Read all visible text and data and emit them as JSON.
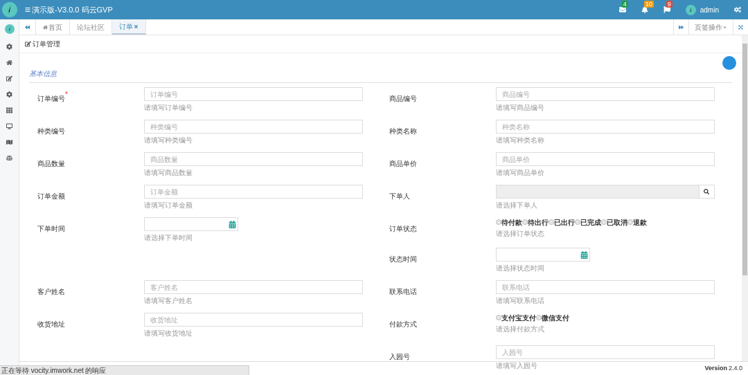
{
  "header": {
    "title": "演示版-V3.0.0 码云GVP",
    "badges": [
      {
        "kind": "mail",
        "count": "4",
        "color": "#1e9e4a"
      },
      {
        "kind": "bell",
        "count": "10",
        "color": "#f39c12"
      },
      {
        "kind": "flag",
        "count": "9",
        "color": "#dd4b39"
      }
    ],
    "user": "admin"
  },
  "tabs": [
    {
      "label": "首页",
      "selected": false
    },
    {
      "label": "论坛社区",
      "selected": false
    },
    {
      "label": "订单",
      "selected": true
    }
  ],
  "tab_menu": "页签操作",
  "panel": {
    "title": "订单管理",
    "section": "基本信息"
  },
  "rows": [
    {
      "left": {
        "kind": "text",
        "label": "订单编号",
        "required_mark": "*",
        "placeholder": "订单编号",
        "help": "请填写订单编号"
      },
      "right": {
        "kind": "text",
        "label": "商品编号",
        "placeholder": "商品编号",
        "help": "请填写商品编号"
      }
    },
    {
      "left": {
        "kind": "text",
        "label": "种类编号",
        "placeholder": "种类编号",
        "help": "请填写种类编号"
      },
      "right": {
        "kind": "text",
        "label": "种类名称",
        "placeholder": "种类名称",
        "help": "请填写种类名称"
      }
    },
    {
      "left": {
        "kind": "text",
        "label": "商品数量",
        "placeholder": "商品数量",
        "help": "请填写商品数量"
      },
      "right": {
        "kind": "text",
        "label": "商品单价",
        "placeholder": "商品单价",
        "help": "请填写商品单价"
      }
    },
    {
      "left": {
        "kind": "text",
        "label": "订单金额",
        "placeholder": "订单金额",
        "help": "请填写订单金额"
      },
      "right": {
        "kind": "lookup",
        "label": "下单人",
        "help": "请选择下单人"
      }
    },
    {
      "left": {
        "kind": "date",
        "label": "下单时间",
        "help": "请选择下单时间"
      },
      "right": {
        "kind": "radio",
        "label": "订单状态",
        "help": "请选择订单状态",
        "options": [
          {
            "label": "待付款",
            "selected": false
          },
          {
            "label": "待出行",
            "selected": false
          },
          {
            "label": "已出行",
            "selected": false
          },
          {
            "label": "已完成",
            "selected": false
          },
          {
            "label": "已取消",
            "selected": false
          },
          {
            "label": "退款",
            "selected": false
          }
        ]
      }
    },
    {
      "right": {
        "kind": "date",
        "label": "状态时间",
        "help": "请选择状态时间"
      }
    },
    {
      "left": {
        "kind": "text",
        "label": "客户姓名",
        "placeholder": "客户姓名",
        "help": "请填写客户姓名"
      },
      "right": {
        "kind": "text",
        "label": "联系电话",
        "placeholder": "联系电话",
        "help": "请填写联系电话"
      }
    },
    {
      "left": {
        "kind": "text",
        "label": "收货地址",
        "placeholder": "收货地址",
        "help": "请填写收货地址"
      },
      "right": {
        "kind": "radio",
        "label": "付款方式",
        "help": "请选择付款方式",
        "options": [
          {
            "label": "支付宝支付",
            "selected": false
          },
          {
            "label": "微信支付",
            "selected": false
          }
        ]
      }
    },
    {
      "right": {
        "kind": "text",
        "label": "入园号",
        "placeholder": "入园号",
        "help": "请填写入园号"
      }
    }
  ],
  "footer": {
    "version_label": "Version",
    "version": "2.4.0"
  },
  "status_bar": "正在等待 vocity.imwork.net 的响应"
}
